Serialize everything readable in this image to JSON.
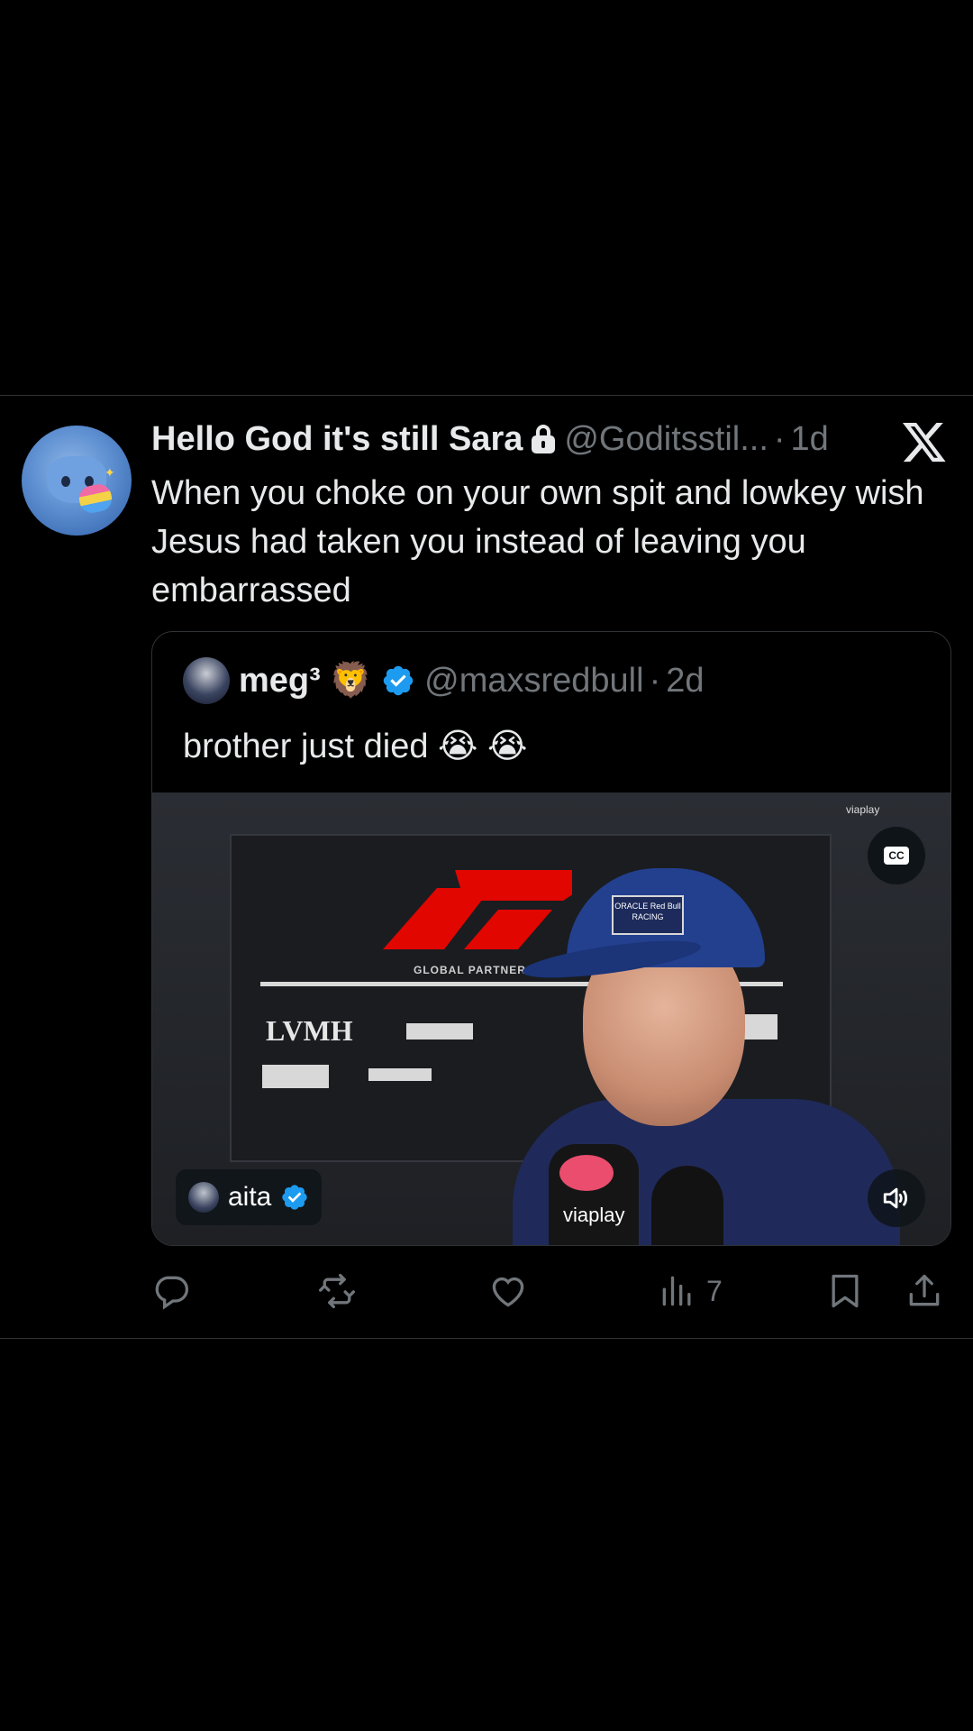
{
  "tweet": {
    "display_name": "Hello God it's still Sara",
    "handle": "@Goditsstil...",
    "separator": "·",
    "time": "1d",
    "text": "When you choke on your own spit and lowkey wish Jesus had taken you instead of leaving you embarrassed",
    "icons": [
      "lock-icon",
      "x-logo-icon"
    ]
  },
  "quote": {
    "display_name": "meg³",
    "name_emoji": "🦁",
    "handle": "@maxsredbull",
    "separator": "·",
    "time": "2d",
    "text": "brother just died 😭 😭",
    "media": {
      "broadcaster_tag": "viaplay",
      "cc_label": "CC",
      "backdrop_brand": "LVMH",
      "mic_label": "viaplay",
      "attribution_name": "aita",
      "cap_text": "ORACLE Red Bull RACING"
    }
  },
  "actions": {
    "reply_icon": "reply-icon",
    "retweet_icon": "retweet-icon",
    "like_icon": "like-icon",
    "views_icon": "views-icon",
    "view_count": "7",
    "bookmark_icon": "bookmark-icon",
    "share_icon": "share-icon"
  },
  "colors": {
    "background": "#000000",
    "text_primary": "#e7e9ea",
    "text_secondary": "#71767b",
    "verified_blue": "#1d9bf0",
    "divider": "#2f3336"
  }
}
